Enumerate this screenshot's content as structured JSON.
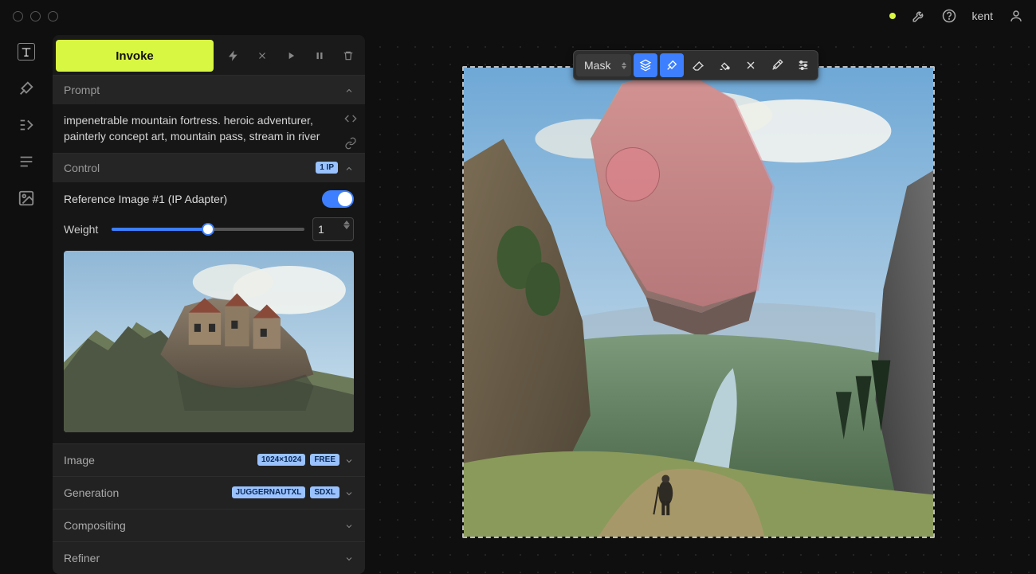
{
  "header": {
    "username": "kent"
  },
  "sidebar": {
    "invoke_label": "Invoke",
    "prompt": {
      "title": "Prompt",
      "text": "impenetrable mountain fortress. heroic adventurer, painterly concept art, mountain pass, stream in river"
    },
    "control": {
      "title": "Control",
      "badge": "1 IP",
      "ref_image_label": "Reference Image #1 (IP Adapter)",
      "ref_enabled": true,
      "weight_label": "Weight",
      "weight_value": "1"
    },
    "image_section": {
      "title": "Image",
      "resolution_badge": "1024×1024",
      "free_badge": "FREE"
    },
    "generation_section": {
      "title": "Generation",
      "model_badge": "JUGGERNAUTXL",
      "arch_badge": "SDXL"
    },
    "compositing_section": {
      "title": "Compositing"
    },
    "refiner_section": {
      "title": "Refiner"
    }
  },
  "canvas": {
    "mode_label": "Mask"
  }
}
